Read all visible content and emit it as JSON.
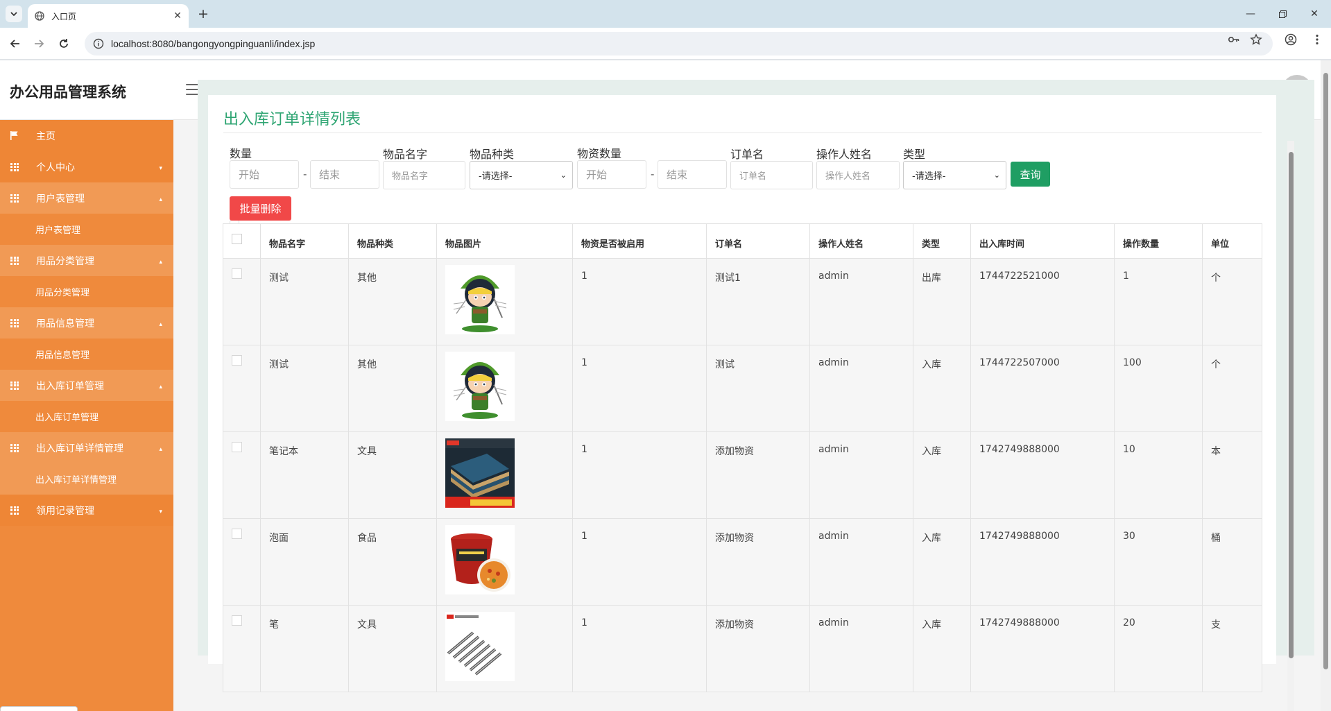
{
  "browser": {
    "tab_title": "入口页",
    "url": "localhost:8080/bangongyongpinguanli/index.jsp"
  },
  "app": {
    "brand": "办公用品管理系统",
    "avatar_text": "80x80"
  },
  "sidebar": {
    "items": [
      {
        "label": "主页",
        "icon": "flag-icon"
      },
      {
        "label": "个人中心",
        "icon": "grid-icon"
      },
      {
        "label": "用户表管理",
        "icon": "grid-icon",
        "sub": "用户表管理"
      },
      {
        "label": "用品分类管理",
        "icon": "grid-icon",
        "sub": "用品分类管理"
      },
      {
        "label": "用品信息管理",
        "icon": "grid-icon",
        "sub": "用品信息管理"
      },
      {
        "label": "出入库订单管理",
        "icon": "grid-icon",
        "sub": "出入库订单管理"
      },
      {
        "label": "出入库订单详情管理",
        "icon": "grid-icon",
        "sub": "出入库订单详情管理"
      },
      {
        "label": "领用记录管理",
        "icon": "grid-icon"
      }
    ]
  },
  "page": {
    "title": "出入库订单详情列表"
  },
  "filters": {
    "qty_label": "数量",
    "qty_start_placeholder": "开始",
    "qty_end_placeholder": "结束",
    "name_label": "物品名字",
    "name_placeholder": "物品名字",
    "category_label": "物品种类",
    "category_value": "-请选择-",
    "stock_label": "物资数量",
    "stock_start_placeholder": "开始",
    "stock_end_placeholder": "结束",
    "order_label": "订单名",
    "order_placeholder": "订单名",
    "operator_label": "操作人姓名",
    "operator_placeholder": "操作人姓名",
    "type_label": "类型",
    "type_value": "-请选择-",
    "query_button": "查询",
    "batch_delete_button": "批量删除",
    "dash": "-"
  },
  "table": {
    "headers": [
      "物品名字",
      "物品种类",
      "物品图片",
      "物资是否被启用",
      "订单名",
      "操作人姓名",
      "类型",
      "出入库时间",
      "操作数量",
      "单位"
    ],
    "rows": [
      {
        "name": "测试",
        "category": "其他",
        "image": "cartoon-elf",
        "enabled": "1",
        "order": "测试1",
        "operator": "admin",
        "type": "出库",
        "time": "1744722521000",
        "qty": "1",
        "unit": "个"
      },
      {
        "name": "测试",
        "category": "其他",
        "image": "cartoon-elf",
        "enabled": "1",
        "order": "测试",
        "operator": "admin",
        "type": "入库",
        "time": "1744722507000",
        "qty": "100",
        "unit": "个"
      },
      {
        "name": "笔记本",
        "category": "文具",
        "image": "notebook",
        "enabled": "1",
        "order": "添加物资",
        "operator": "admin",
        "type": "入库",
        "time": "1742749888000",
        "qty": "10",
        "unit": "本"
      },
      {
        "name": "泡面",
        "category": "食品",
        "image": "instant-noodles",
        "enabled": "1",
        "order": "添加物资",
        "operator": "admin",
        "type": "入库",
        "time": "1742749888000",
        "qty": "30",
        "unit": "桶"
      },
      {
        "name": "笔",
        "category": "文具",
        "image": "pens",
        "enabled": "1",
        "order": "添加物资",
        "operator": "admin",
        "type": "入库",
        "time": "1742749888000",
        "qty": "20",
        "unit": "支"
      }
    ]
  },
  "colors": {
    "sidebar": "#ef8a3c",
    "title_green": "#2fa573",
    "query_green": "#1f9e63",
    "delete_red": "#f14848"
  }
}
